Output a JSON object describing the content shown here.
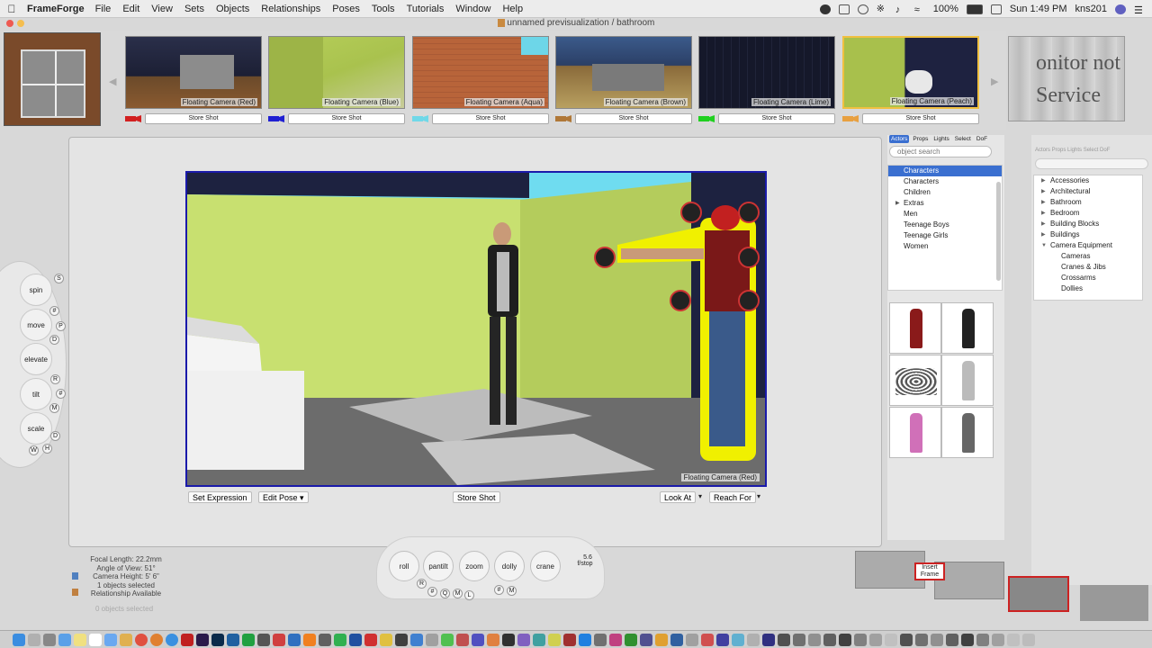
{
  "menubar": {
    "app_name": "FrameForge",
    "items": [
      "File",
      "Edit",
      "View",
      "Sets",
      "Objects",
      "Relationships",
      "Poses",
      "Tools",
      "Tutorials",
      "Window",
      "Help"
    ],
    "battery": "100%",
    "clock": "Sun 1:49 PM",
    "user": "kns201"
  },
  "window": {
    "title": "unnamed previsualization / bathroom"
  },
  "shots": [
    {
      "label": "Floating Camera (Red)",
      "color": "#d22020",
      "store": "Store Shot"
    },
    {
      "label": "Floating Camera (Blue)",
      "color": "#2020d2",
      "store": "Store Shot"
    },
    {
      "label": "Floating Camera (Aqua)",
      "color": "#70d8e8",
      "store": "Store Shot"
    },
    {
      "label": "Floating Camera (Brown)",
      "color": "#b07838",
      "store": "Store Shot"
    },
    {
      "label": "Floating Camera (Lime)",
      "color": "#20d020",
      "store": "Store Shot"
    },
    {
      "label": "Floating Camera (Peach)",
      "color": "#e8a040",
      "store": "Store Shot"
    }
  ],
  "monitor": {
    "line1": "onitor not",
    "line2": "Service"
  },
  "viewport": {
    "label": "Floating Camera (Red)",
    "buttons": {
      "set_expression": "Set Expression",
      "edit_pose": "Edit Pose",
      "store_shot": "Store Shot",
      "look_at": "Look At",
      "reach_for": "Reach For"
    }
  },
  "left_controls": {
    "spin": "spin",
    "move": "move",
    "elevate": "elevate",
    "tilt": "tilt",
    "scale": "scale",
    "keys": {
      "s": "S",
      "hash1": "#",
      "p": "P",
      "d1": "D",
      "r": "R",
      "hash2": "#",
      "m": "M",
      "d2": "D",
      "w": "W",
      "h": "H"
    }
  },
  "camera_dials": {
    "roll": "roll",
    "pan": "pan",
    "tilt": "tilt",
    "zoom": "zoom",
    "dolly": "dolly",
    "crane": "crane",
    "fstop_value": "5.6",
    "fstop_label": "f/stop",
    "keys": {
      "r": "R",
      "hash1": "#",
      "q": "Q",
      "m1": "M",
      "l": "L",
      "hash2": "#",
      "m2": "M"
    }
  },
  "camera_stats": {
    "focal_length": "Focal Length: 22.2mm",
    "angle_of_view": "Angle of View: 51°",
    "camera_height": "Camera Height: 5' 6\"",
    "selected": "1 objects selected",
    "relationship": "Relationship Available",
    "objects_selected_faded": "0 objects selected"
  },
  "actors_panel": {
    "tabs": [
      "Actors",
      "Props",
      "Lights",
      "Select",
      "DoF"
    ],
    "active_tab": "Actors",
    "search_placeholder": "object search",
    "categories": [
      "Characters",
      "Characters",
      "Children",
      "Extras",
      "Men",
      "Teenage Boys",
      "Teenage Girls",
      "Women"
    ]
  },
  "props_panel": {
    "tabs": "Actors  Props  Lights  Select  DoF",
    "items": [
      "Accessories",
      "Architectural",
      "Bathroom",
      "Bedroom",
      "Building Blocks",
      "Buildings",
      "Camera Equipment"
    ],
    "sub_items": [
      "Cameras",
      "Cranes & Jibs",
      "Crossarms",
      "Dollies"
    ]
  },
  "timeline": {
    "insert_line1": "Insert",
    "insert_line2": "Frame"
  }
}
